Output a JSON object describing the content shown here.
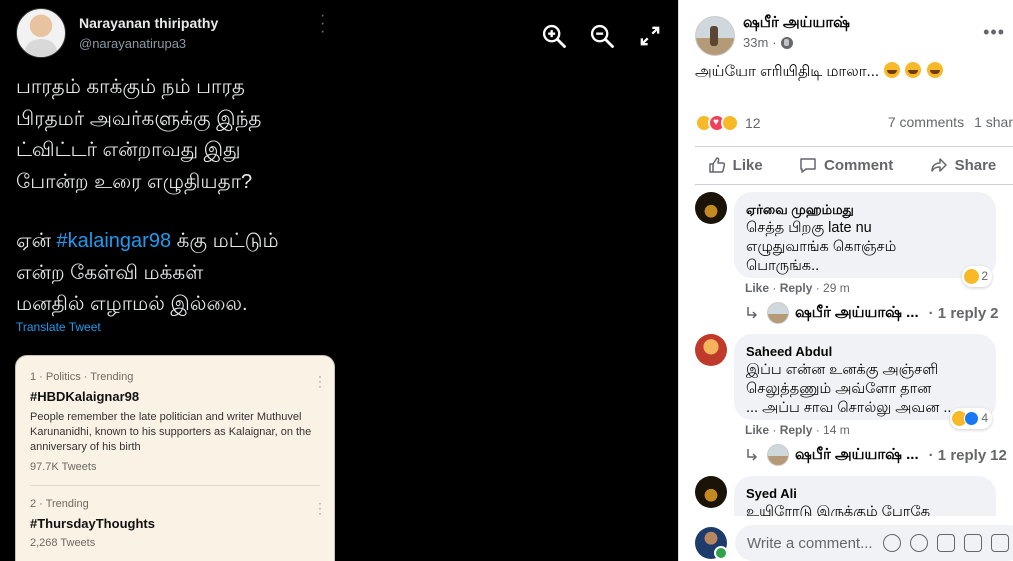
{
  "tweet": {
    "author_name": "Narayanan thiripathy",
    "author_handle": "@narayanatirupa3",
    "text_lines_1": "பாரதம் காக்கும் நம் பாரத\nபிரதமர் அவர்களுக்கு இந்த\nட்விட்டர் என்றாவது இது\nபோன்ற உரை எழுதியதா?",
    "text2_prefix": "ஏன் ",
    "hashtag": "#kalaingar98",
    "text2_suffix": " க்கு மட்டும்\nஎன்ற  கேள்வி மக்கள்\nமனதில் எழாமல் இல்லை.",
    "translate_label": "Translate Tweet",
    "trends": [
      {
        "meta": "1 · Politics · Trending",
        "tag": "#HBDKalaignar98",
        "desc": "People remember the late politician and writer Muthuvel Karunanidhi, known to his supporters as Kalaignar, on the anniversary of his birth",
        "count": "97.7K Tweets"
      },
      {
        "meta": "2 · Trending",
        "tag": "#ThursdayThoughts",
        "count": "2,268 Tweets"
      }
    ]
  },
  "post": {
    "author": "ஷபீர் அய்யாஷ்",
    "time": "33m",
    "text": "அய்யோ எரியிதிடி மாலா...",
    "reaction_count": "12",
    "comments_count": "7 comments",
    "shares_count": "1 shar",
    "actions": {
      "like": "Like",
      "comment": "Comment",
      "share": "Share"
    }
  },
  "comments": [
    {
      "name": "ஏர்வை முஹம்மது",
      "text": "செத்த பிறகு late nu\nஎழுதுவாங்க கொஞ்சம்\nபொருங்க..",
      "reacts": "2",
      "like": "Like",
      "reply": "Reply",
      "time": "29 m",
      "reply_author": "ஷபீர் அய்யாஷ் ...",
      "reply_count": "· 1 reply",
      "reply_extra": "2"
    },
    {
      "name": "Saheed Abdul",
      "text": "இப்ப என்ன உனக்கு அஞ்சளி\nசெலுத்தணும் அவ்ளோ தான\n... அப்ப சாவ சொல்லு அவன ..",
      "reacts": "4",
      "like": "Like",
      "reply": "Reply",
      "time": "14 m",
      "reply_author": "ஷபீர் அய்யாஷ் ...",
      "reply_count": "· 1 reply",
      "reply_extra": "12"
    },
    {
      "name": "Syed Ali",
      "text": "உயிரோடு இருக்கும் போதே"
    }
  ],
  "composer": {
    "placeholder": "Write a comment..."
  }
}
